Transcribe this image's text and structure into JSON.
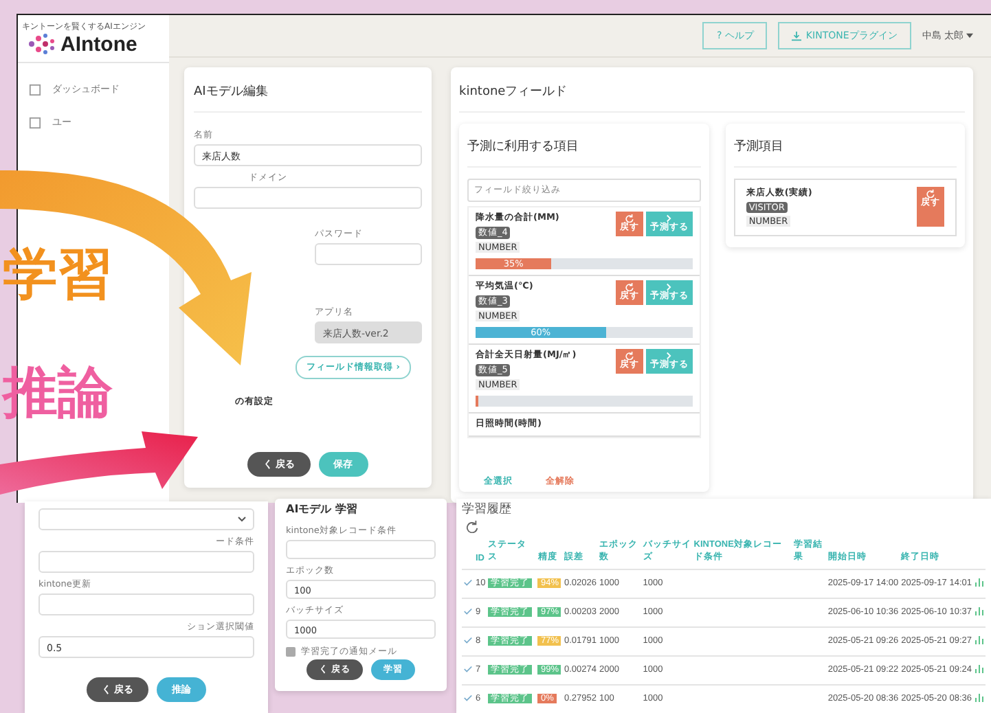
{
  "app": {
    "logo": {
      "tagline": "キントーンを賢くするAIエンジン",
      "name": "AIntone"
    },
    "header": {
      "help": "? ヘルプ",
      "plugin": "KINTONEプラグイン",
      "user": "中島 太郎"
    },
    "sidebar": {
      "items": [
        {
          "label": "ダッシュボード",
          "selected": false
        },
        {
          "label": "ユー",
          "selected": false
        }
      ]
    },
    "model_edit": {
      "title": "AIモデル編集",
      "name_label": "名前",
      "name_value": "来店人数",
      "domain_label": "ドメイン",
      "password_label": "パスワード",
      "app_label": "アプリ名",
      "app_value": "来店人数-ver.2",
      "fetch_button": "フィールド情報取得 ›",
      "note": "の有設定",
      "back": "く 戻る",
      "save": "保存"
    },
    "kintone_fields": {
      "title": "kintoneフィールド",
      "features": {
        "title": "予測に利用する項目",
        "filter_placeholder": "フィールド絞り込み",
        "items": [
          {
            "name": "降水量の合計(MM)",
            "code": "数値_4",
            "type": "NUMBER",
            "level": 0.35,
            "percent": "35%",
            "color": "#e57a5c",
            "back": "戻す",
            "predict": "予測する"
          },
          {
            "name": "平均気温(℃)",
            "code": "数値_3",
            "type": "NUMBER",
            "level": 0.6,
            "percent": "60%",
            "color": "#4cb3d4",
            "back": "戻す",
            "predict": "予測する"
          },
          {
            "name": "合計全天日射量(MJ/㎡)",
            "code": "数値_5",
            "type": "NUMBER",
            "level": 0.01,
            "color": "#e57a5c",
            "back": "戻す",
            "predict": "予測する"
          },
          {
            "name": "日照時間(時間)"
          }
        ],
        "select_all": "全選択",
        "clear_all": "全解除"
      },
      "target": {
        "title": "予測項目",
        "name": "来店人数(実績)",
        "code": "VISITOR",
        "type": "NUMBER",
        "back": "戻す"
      }
    }
  },
  "inference": {
    "condition_label": "ード条件",
    "update_label": "kintone更新",
    "threshold_label": "ション選択閾値",
    "threshold_value": "0.5",
    "back": "く 戻る",
    "run": "推論"
  },
  "training": {
    "title": "AIモデル 学習",
    "condition_label": "kintone対象レコード条件",
    "epochs_label": "エポック数",
    "epochs_value": "100",
    "batch_label": "バッチサイズ",
    "batch_value": "1000",
    "notify_label": "学習完了の通知メール",
    "notify_checked": false,
    "back": "く 戻る",
    "train": "学習"
  },
  "history": {
    "title": "学習履歴",
    "columns": [
      "ID",
      "ステータス",
      "精度",
      "誤差",
      "エポック数",
      "バッチサイズ",
      "KINTONE対象レコード条件",
      "学習結果",
      "開始日時",
      "終了日時"
    ],
    "rows": [
      {
        "id": "10",
        "status": "学習完了",
        "accuracy": "94%",
        "color": "#f2c14e",
        "error": "0.02026",
        "epochs": "1000",
        "batch": "1000",
        "start": "2025-09-17 14:00",
        "end": "2025-09-17 14:01"
      },
      {
        "id": "9",
        "status": "学習完了",
        "accuracy": "97%",
        "color": "#5cc48a",
        "error": "0.00203",
        "epochs": "2000",
        "batch": "1000",
        "start": "2025-06-10 10:36",
        "end": "2025-06-10 10:37"
      },
      {
        "id": "8",
        "status": "学習完了",
        "accuracy": "77%",
        "color": "#f2c14e",
        "error": "0.01791",
        "epochs": "1000",
        "batch": "1000",
        "start": "2025-05-21 09:26",
        "end": "2025-05-21 09:27"
      },
      {
        "id": "7",
        "status": "学習完了",
        "accuracy": "99%",
        "color": "#5cc48a",
        "error": "0.00274",
        "epochs": "2000",
        "batch": "1000",
        "start": "2025-05-21 09:22",
        "end": "2025-05-21 09:24"
      },
      {
        "id": "6",
        "status": "学習完了",
        "accuracy": "0%",
        "color": "#e57a5c",
        "error": "0.27952",
        "epochs": "100",
        "batch": "1000",
        "start": "2025-05-20 08:36",
        "end": "2025-05-20 08:36"
      }
    ]
  },
  "overlay": {
    "learn": "学習",
    "infer": "推論"
  }
}
